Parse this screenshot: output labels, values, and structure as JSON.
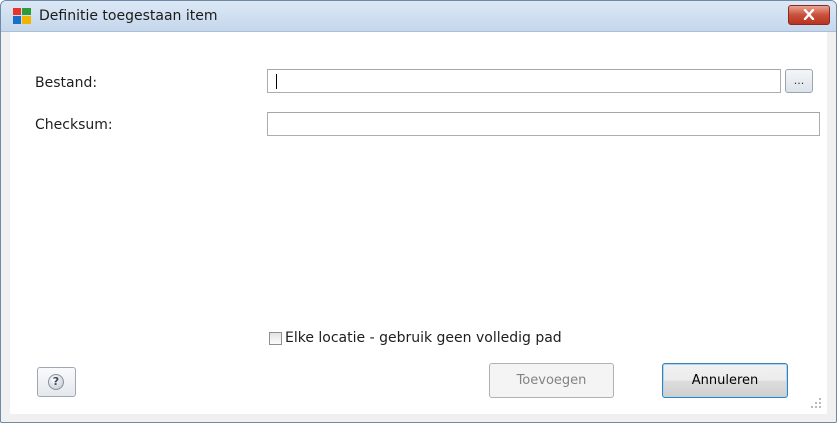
{
  "window": {
    "title": "Definitie toegestaan item",
    "close_icon": "close-icon"
  },
  "form": {
    "file_label": "Bestand:",
    "file_value": "",
    "browse_label": "...",
    "checksum_label": "Checksum:",
    "checksum_value": "",
    "any_location_label": "Elke locatie - gebruik geen volledig pad",
    "any_location_checked": false
  },
  "buttons": {
    "help_icon": "help-icon",
    "add_label": "Toevoegen",
    "cancel_label": "Annuleren"
  },
  "colors": {
    "title_bar": "#c5d7ec",
    "close": "#c9503b",
    "default_border": "#3c7fb1"
  }
}
